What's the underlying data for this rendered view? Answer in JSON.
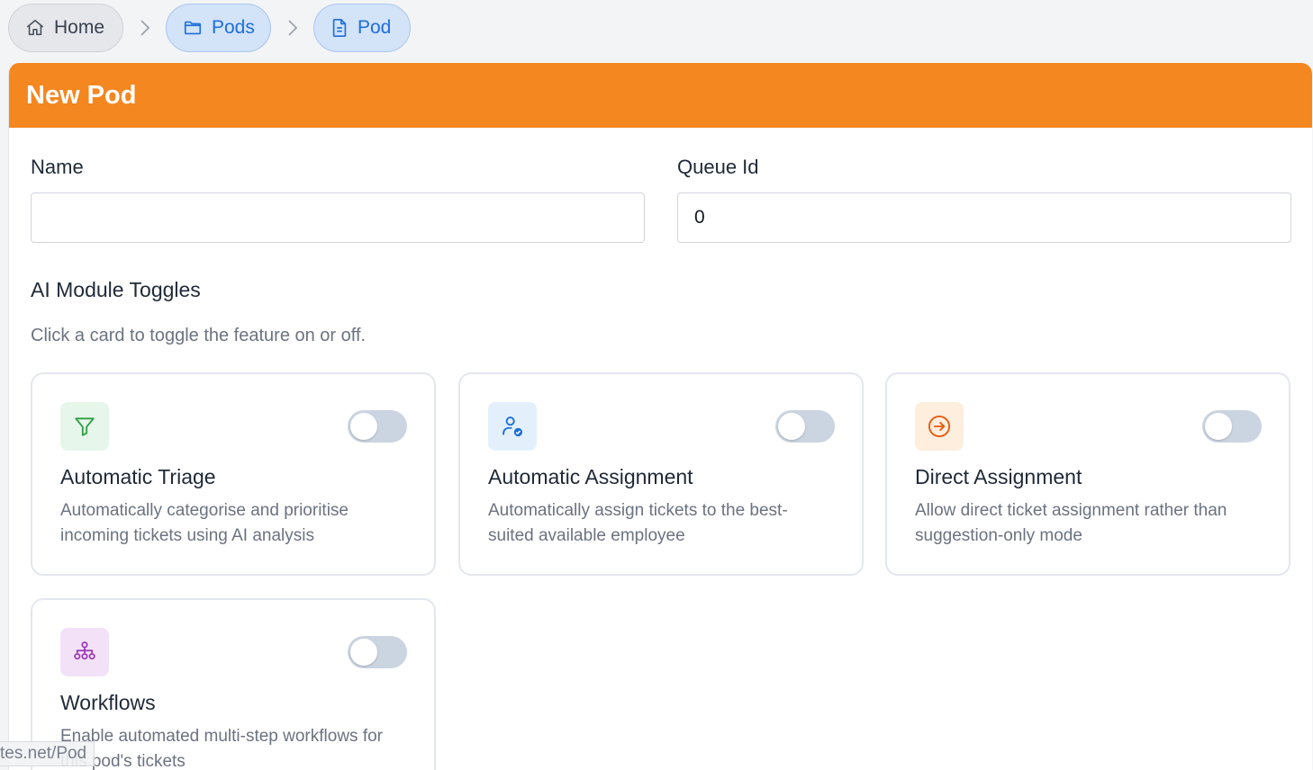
{
  "breadcrumb": {
    "home": "Home",
    "pods": "Pods",
    "pod": "Pod"
  },
  "header": {
    "title": "New Pod"
  },
  "form": {
    "name_label": "Name",
    "name_value": "",
    "queue_label": "Queue Id",
    "queue_value": "0"
  },
  "modules": {
    "title": "AI Module Toggles",
    "subtitle": "Click a card to toggle the feature on or off.",
    "items": [
      {
        "title": "Automatic Triage",
        "description": "Automatically categorise and prioritise incoming tickets using AI analysis",
        "icon": "filter-icon",
        "enabled": false
      },
      {
        "title": "Automatic Assignment",
        "description": "Automatically assign tickets to the best-suited available employee",
        "icon": "user-check-icon",
        "enabled": false
      },
      {
        "title": "Direct Assignment",
        "description": "Allow direct ticket assignment rather than suggestion-only mode",
        "icon": "arrow-right-circle-icon",
        "enabled": false
      },
      {
        "title": "Workflows",
        "description": "Enable automated multi-step workflows for this pod's tickets",
        "icon": "hierarchy-icon",
        "enabled": false
      }
    ]
  },
  "status_bar": {
    "url": "tes.net/Pod"
  },
  "colors": {
    "header_bg": "#f58720",
    "breadcrumb_active": "#1e6fd9",
    "toggle_off": "#cbd5e1",
    "triage_icon_bg": "#e6f6ea",
    "assign_icon_bg": "#e3f0fc",
    "direct_icon_bg": "#fdeedd",
    "workflow_icon_bg": "#f3e2f7"
  }
}
